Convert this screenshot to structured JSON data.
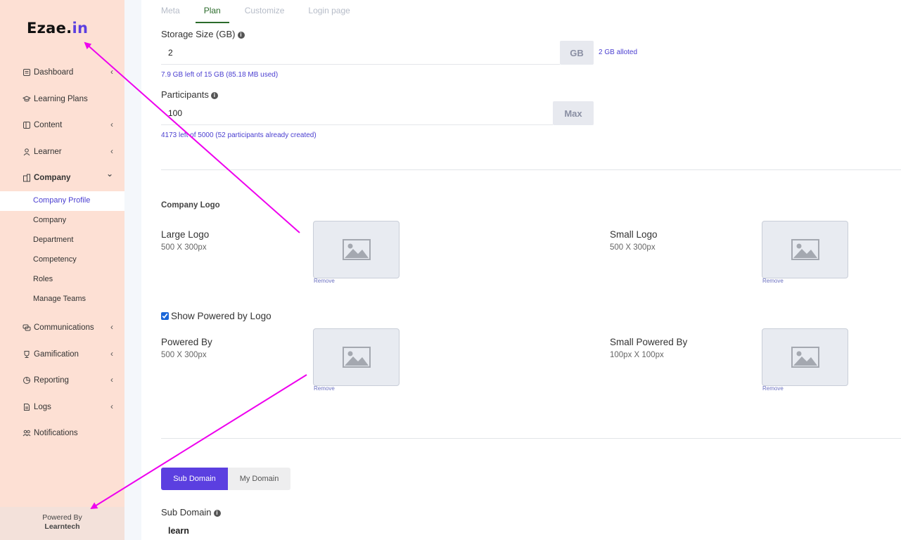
{
  "brand": {
    "name_main": "Ezae.",
    "name_accent": "in"
  },
  "sidebar": {
    "items": [
      {
        "label": "Dashboard",
        "icon": "dashboard-icon",
        "has_chevron": true
      },
      {
        "label": "Learning Plans",
        "icon": "graduation-cap-icon",
        "has_chevron": false
      },
      {
        "label": "Content",
        "icon": "content-icon",
        "has_chevron": true
      },
      {
        "label": "Learner",
        "icon": "learner-icon",
        "has_chevron": true
      },
      {
        "label": "Company",
        "icon": "building-icon",
        "has_chevron": true,
        "expanded": true
      },
      {
        "label": "Communications",
        "icon": "chat-icon",
        "has_chevron": true
      },
      {
        "label": "Gamification",
        "icon": "trophy-icon",
        "has_chevron": true
      },
      {
        "label": "Reporting",
        "icon": "pie-chart-icon",
        "has_chevron": true
      },
      {
        "label": "Logs",
        "icon": "document-icon",
        "has_chevron": true
      },
      {
        "label": "Notifications",
        "icon": "users-icon",
        "has_chevron": false
      }
    ],
    "company_sub": [
      "Company Profile",
      "Company",
      "Department",
      "Competency",
      "Roles",
      "Manage Teams"
    ],
    "chevron_left": "‹",
    "chevron_down": "⌄",
    "powered_by": "Powered By",
    "powered_brand": "Learntech"
  },
  "tabs": [
    "Meta",
    "Plan",
    "Customize",
    "Login page"
  ],
  "plan": {
    "storage_label": "Storage Size (GB)",
    "storage_value": "2",
    "storage_addon": "GB",
    "storage_alloted": "2 GB alloted",
    "storage_hint": "7.9 GB left of 15 GB (85.18 MB used)",
    "participants_label": "Participants",
    "participants_value": "100",
    "participants_addon": "Max",
    "participants_hint": "4173 left of 5000 (52 participants already created)"
  },
  "logos": {
    "section_title": "Company Logo",
    "large_label": "Large Logo",
    "large_size": "500 X 300px",
    "small_label": "Small Logo",
    "small_size": "500 X 300px",
    "show_powered_label": "Show Powered by Logo",
    "show_powered_checked": true,
    "powered_label": "Powered By",
    "powered_size": "500 X 300px",
    "small_powered_label": "Small Powered By",
    "small_powered_size": "100px X 100px",
    "remove_label": "Remove"
  },
  "domain": {
    "tabs": [
      "Sub Domain",
      "My Domain"
    ],
    "sub_domain_label": "Sub Domain",
    "sub_domain_value": "learn"
  },
  "colors": {
    "accent": "#5b3fe0",
    "sidebar_bg": "#fde0d4",
    "annotation_arrow": "#ee00ee",
    "active_tab": "#2b6b2b"
  },
  "info_icon": "i"
}
